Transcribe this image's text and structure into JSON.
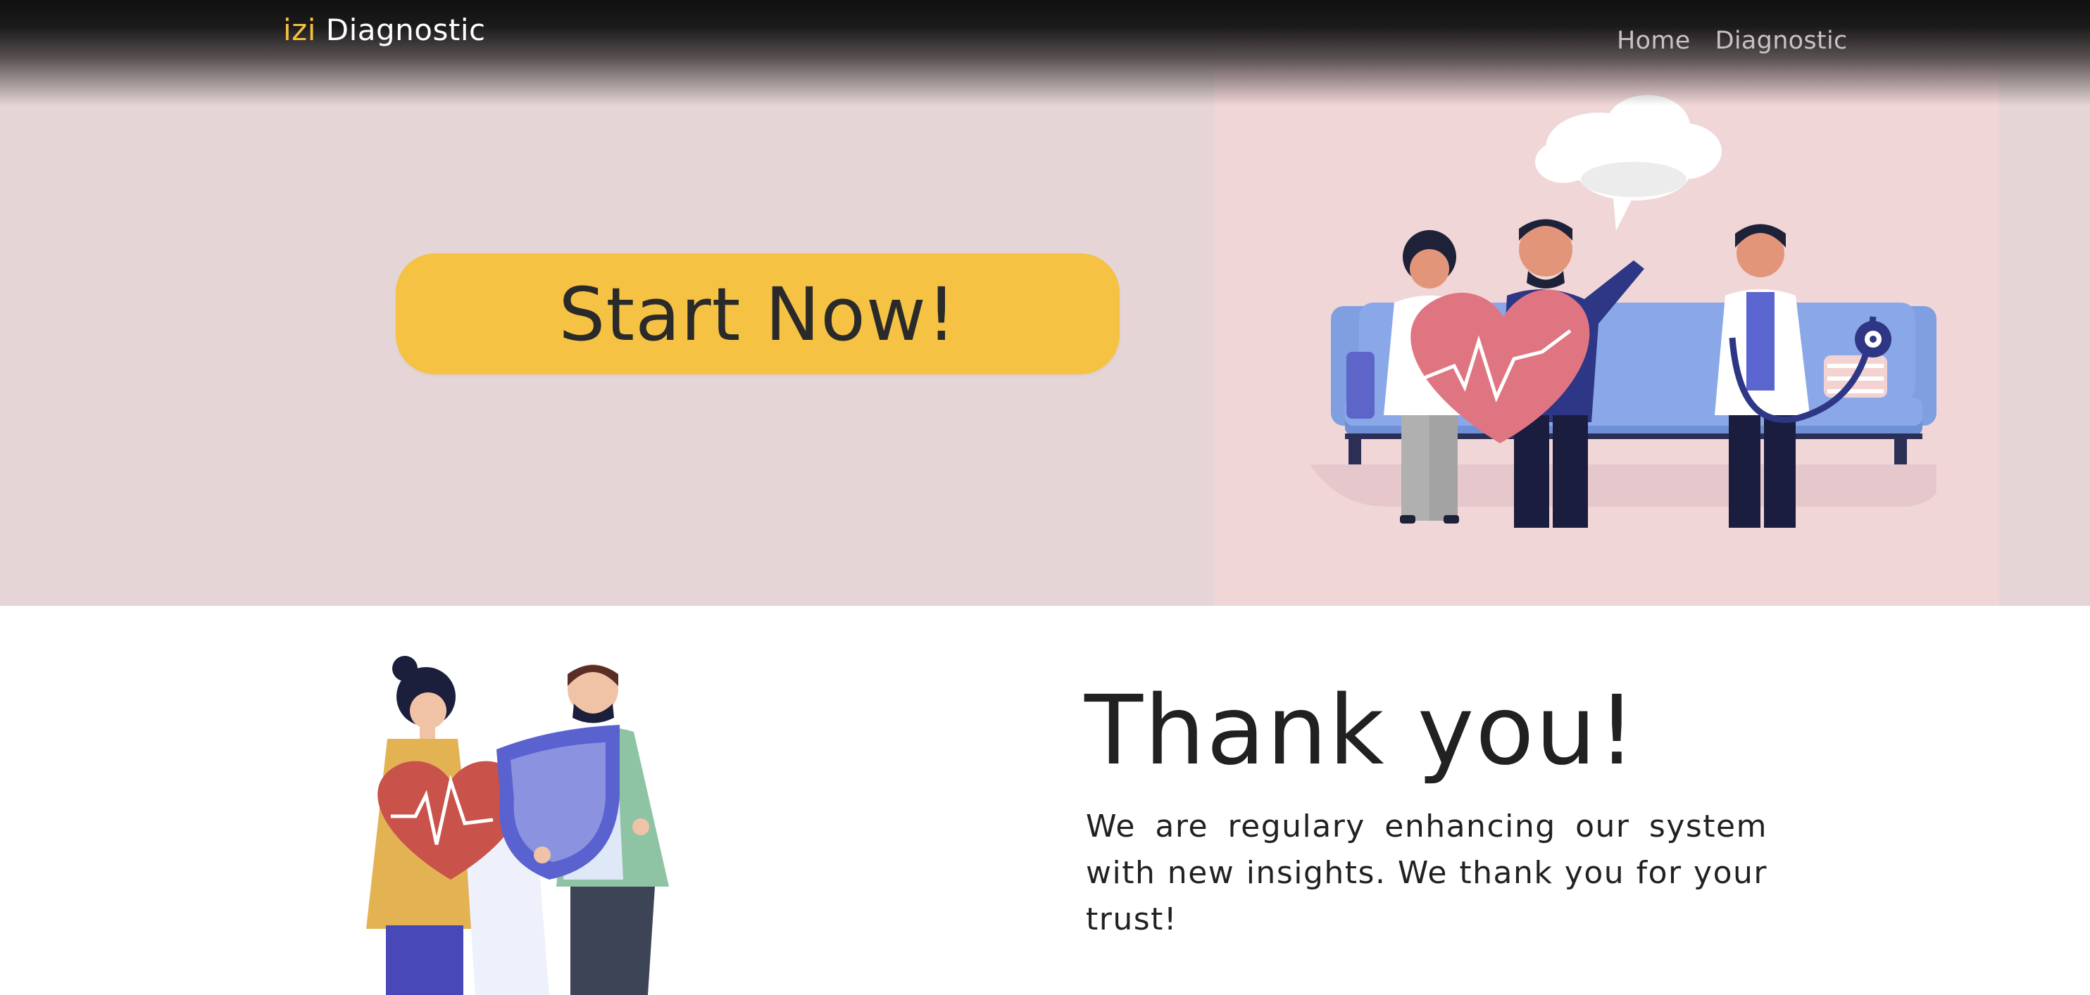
{
  "header": {
    "brand_accent": "izi",
    "brand_rest": "Diagnostic",
    "nav": [
      {
        "label": "Home"
      },
      {
        "label": "Diagnostic"
      }
    ]
  },
  "hero": {
    "cta_label": "Start Now!",
    "illustration": "doctor-consultation-couch-illustration"
  },
  "thanks": {
    "title": "Thank you!",
    "message": "We are regulary enhancing our system with new insights. We thank you for your trust!",
    "illustration": "couple-heart-shield-illustration"
  },
  "colors": {
    "accent": "#f5c244",
    "hero_bg": "#e6d5d6",
    "text": "#212121"
  }
}
